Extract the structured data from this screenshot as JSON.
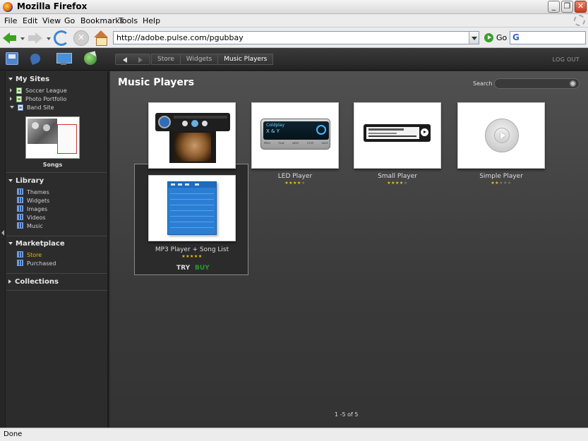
{
  "window": {
    "title": "Mozilla Firefox"
  },
  "menu": [
    "File",
    "Edit",
    "View",
    "Go",
    "Bookmarks",
    "Tools",
    "Help"
  ],
  "navbar": {
    "url": "http://adobe.pulse.com/pgubbay",
    "go_label": "Go"
  },
  "app": {
    "breadcrumbs": [
      "Store",
      "Widgets",
      "Music Players"
    ],
    "logout": "LOG OUT"
  },
  "sidebar": {
    "my_sites": {
      "title": "My Sites",
      "items": [
        "Soccer League",
        "Photo Portfolio",
        "Band Site"
      ],
      "thumb_label": "Songs"
    },
    "library": {
      "title": "Library",
      "items": [
        "Themes",
        "Widgets",
        "Images",
        "Videos",
        "Music"
      ]
    },
    "marketplace": {
      "title": "Marketplace",
      "items": [
        "Store",
        "Purchased"
      ]
    },
    "collections": {
      "title": "Collections"
    }
  },
  "main": {
    "title": "Music Players",
    "search_label": "Search",
    "products": [
      {
        "name": "",
        "rating": 0
      },
      {
        "name": "LED Player",
        "rating": 4,
        "preview": {
          "line1": "Coldplay",
          "line2": "X & Y",
          "keys": [
            "PREV",
            "PLAY",
            "NEXT",
            "STOP",
            "SHUF"
          ]
        }
      },
      {
        "name": "Small Player",
        "rating": 4
      },
      {
        "name": "Simple Player",
        "rating": 2
      },
      {
        "name": "MP3 Player + Song List",
        "rating": 5
      }
    ],
    "actions": {
      "try": "TRY",
      "buy": "BUY"
    },
    "pager": "1 -5 of 5"
  },
  "status": "Done",
  "colors": {
    "accent_store": "#e6b800",
    "buy": "#2a9a2a",
    "stars": "#f0c400"
  }
}
